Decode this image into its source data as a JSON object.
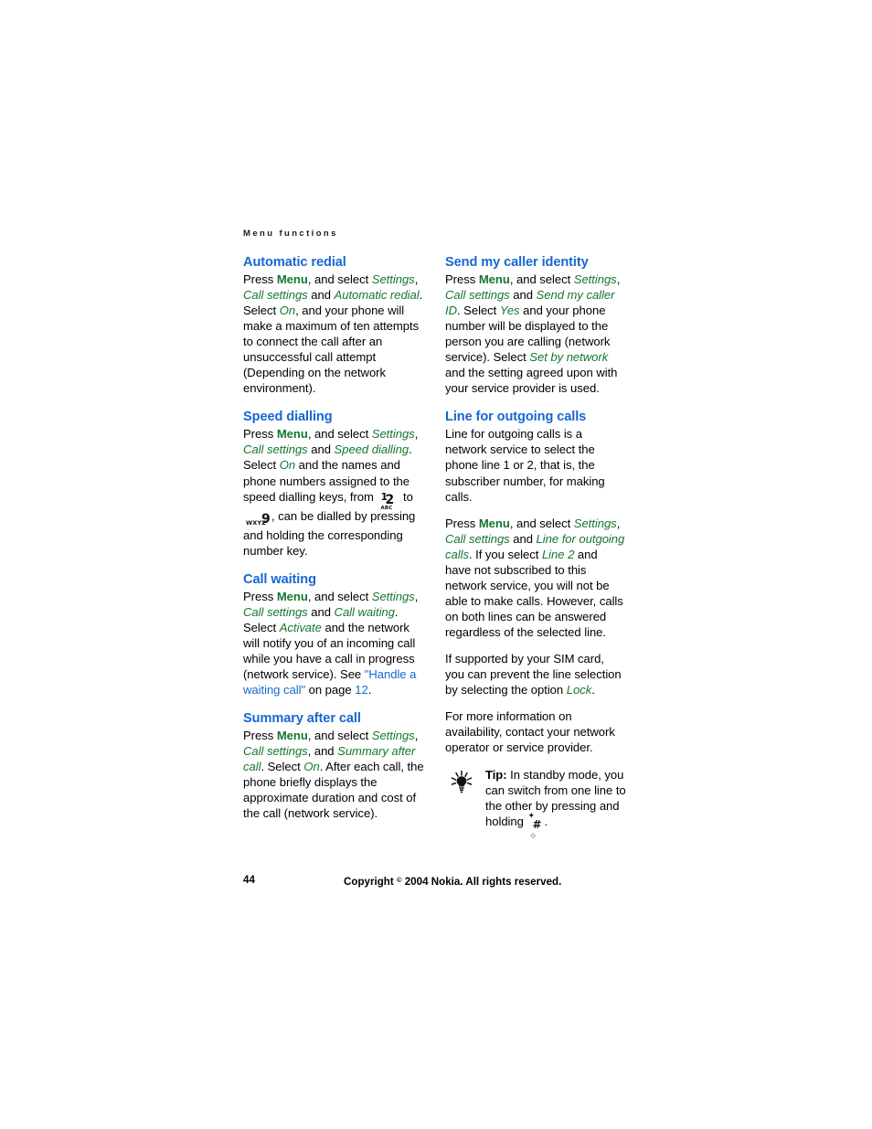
{
  "document": {
    "running_head": "Menu functions",
    "page_number": "44",
    "copyright_prefix": "Copyright ",
    "copyright_symbol": "©",
    "copyright_suffix": " 2004 Nokia. All rights reserved."
  },
  "colors": {
    "heading_blue": "#1767d2",
    "menu_green": "#14772f",
    "link_blue": "#1767d2",
    "body_black": "#000000",
    "page_background": "#ffffff"
  },
  "left_column": {
    "sections": [
      {
        "heading": "Automatic redial",
        "paragraphs": [
          {
            "runs": [
              {
                "t": "Press ",
                "s": "plain"
              },
              {
                "t": "Menu",
                "s": "bold-green"
              },
              {
                "t": ", and select ",
                "s": "plain"
              },
              {
                "t": "Settings",
                "s": "italic-green"
              },
              {
                "t": ", ",
                "s": "plain"
              },
              {
                "t": "Call settings",
                "s": "italic-green"
              },
              {
                "t": " and ",
                "s": "plain"
              },
              {
                "t": "Automatic redial",
                "s": "italic-green"
              },
              {
                "t": ". Select ",
                "s": "plain"
              },
              {
                "t": "On",
                "s": "italic-green"
              },
              {
                "t": ", and your phone will make a maximum of ten attempts to connect the call after an unsuccessful call attempt (Depending on the network environment).",
                "s": "plain"
              }
            ]
          }
        ]
      },
      {
        "heading": "Speed dialling",
        "paragraphs": [
          {
            "runs": [
              {
                "t": "Press ",
                "s": "plain"
              },
              {
                "t": "Menu",
                "s": "bold-green"
              },
              {
                "t": ", and select ",
                "s": "plain"
              },
              {
                "t": "Settings",
                "s": "italic-green"
              },
              {
                "t": ", ",
                "s": "plain"
              },
              {
                "t": "Call settings",
                "s": "italic-green"
              },
              {
                "t": " and ",
                "s": "plain"
              },
              {
                "t": "Speed dialling",
                "s": "italic-green"
              },
              {
                "t": ". Select ",
                "s": "plain"
              },
              {
                "t": "On",
                "s": "italic-green"
              },
              {
                "t": " and the names and phone numbers assigned to the speed dialling keys, from ",
                "s": "plain"
              },
              {
                "t": "key-2-abc",
                "s": "keycap-2"
              },
              {
                "t": " to ",
                "s": "plain"
              },
              {
                "t": "key-9-wxyz",
                "s": "keycap-9"
              },
              {
                "t": ", can be dialled by pressing and holding the corresponding number key.",
                "s": "plain"
              }
            ]
          }
        ]
      },
      {
        "heading": "Call waiting",
        "paragraphs": [
          {
            "runs": [
              {
                "t": "Press ",
                "s": "plain"
              },
              {
                "t": "Menu",
                "s": "bold-green"
              },
              {
                "t": ", and select ",
                "s": "plain"
              },
              {
                "t": "Settings",
                "s": "italic-green"
              },
              {
                "t": ", ",
                "s": "plain"
              },
              {
                "t": "Call settings",
                "s": "italic-green"
              },
              {
                "t": " and ",
                "s": "plain"
              },
              {
                "t": "Call waiting",
                "s": "italic-green"
              },
              {
                "t": ". Select ",
                "s": "plain"
              },
              {
                "t": "Activate",
                "s": "italic-green"
              },
              {
                "t": " and the network will notify you of an incoming call while you have a call in progress (network service). See ",
                "s": "plain"
              },
              {
                "t": "\"Handle a waiting call\"",
                "s": "link"
              },
              {
                "t": " on page ",
                "s": "plain"
              },
              {
                "t": "12",
                "s": "link"
              },
              {
                "t": ".",
                "s": "plain"
              }
            ]
          }
        ]
      },
      {
        "heading": "Summary after call",
        "paragraphs": [
          {
            "runs": [
              {
                "t": "Press ",
                "s": "plain"
              },
              {
                "t": "Menu",
                "s": "bold-green"
              },
              {
                "t": ", and select ",
                "s": "plain"
              },
              {
                "t": "Settings",
                "s": "italic-green"
              },
              {
                "t": ", ",
                "s": "plain"
              },
              {
                "t": "Call settings",
                "s": "italic-green"
              },
              {
                "t": ", and ",
                "s": "plain"
              },
              {
                "t": "Summary after call",
                "s": "italic-green"
              },
              {
                "t": ". Select ",
                "s": "plain"
              },
              {
                "t": "On",
                "s": "italic-green"
              },
              {
                "t": ". After each call, the phone briefly displays the approximate duration and cost of the call (network service).",
                "s": "plain"
              }
            ]
          }
        ]
      }
    ]
  },
  "right_column": {
    "sections": [
      {
        "heading": "Send my caller identity",
        "paragraphs": [
          {
            "runs": [
              {
                "t": "Press ",
                "s": "plain"
              },
              {
                "t": "Menu",
                "s": "bold-green"
              },
              {
                "t": ", and select ",
                "s": "plain"
              },
              {
                "t": "Settings",
                "s": "italic-green"
              },
              {
                "t": ", ",
                "s": "plain"
              },
              {
                "t": "Call settings",
                "s": "italic-green"
              },
              {
                "t": " and ",
                "s": "plain"
              },
              {
                "t": "Send my caller ID",
                "s": "italic-green"
              },
              {
                "t": ". Select ",
                "s": "plain"
              },
              {
                "t": "Yes",
                "s": "italic-green"
              },
              {
                "t": " and your phone number will be displayed to the person you are calling (network service). Select ",
                "s": "plain"
              },
              {
                "t": "Set by network",
                "s": "italic-green"
              },
              {
                "t": " and the setting agreed upon with your service provider is used.",
                "s": "plain"
              }
            ]
          }
        ]
      },
      {
        "heading": "Line for outgoing calls",
        "paragraphs": [
          {
            "runs": [
              {
                "t": "Line for outgoing calls is a network service to select the phone line 1 or 2, that is, the subscriber number, for making calls.",
                "s": "plain"
              }
            ]
          },
          {
            "runs": [
              {
                "t": "Press ",
                "s": "plain"
              },
              {
                "t": "Menu",
                "s": "bold-green"
              },
              {
                "t": ", and select ",
                "s": "plain"
              },
              {
                "t": "Settings",
                "s": "italic-green"
              },
              {
                "t": ", ",
                "s": "plain"
              },
              {
                "t": "Call settings",
                "s": "italic-green"
              },
              {
                "t": " and ",
                "s": "plain"
              },
              {
                "t": "Line for outgoing calls",
                "s": "italic-green"
              },
              {
                "t": ". If you select ",
                "s": "plain"
              },
              {
                "t": "Line 2",
                "s": "italic-green"
              },
              {
                "t": " and have not subscribed to this network service, you will not be able to make calls. However, calls on both lines can be answered regardless of the selected line.",
                "s": "plain"
              }
            ]
          },
          {
            "runs": [
              {
                "t": "If supported by your SIM card, you can prevent the line selection by selecting the option ",
                "s": "plain"
              },
              {
                "t": "Lock",
                "s": "italic-green"
              },
              {
                "t": ".",
                "s": "plain"
              }
            ]
          },
          {
            "runs": [
              {
                "t": "For more information on availability, contact your network operator or service provider.",
                "s": "plain"
              }
            ]
          }
        ],
        "tip": {
          "icon": "lightbulb-tip-icon",
          "label": "Tip:",
          "runs": [
            {
              "t": " In standby mode, you can switch from one line to the other by pressing and holding ",
              "s": "plain"
            },
            {
              "t": "key-hash",
              "s": "keycap-hash"
            },
            {
              "t": ".",
              "s": "plain"
            }
          ]
        }
      }
    ]
  },
  "keycaps": {
    "key2": {
      "number": "2",
      "alpha": "ABC"
    },
    "key9": {
      "number": "9",
      "alpha": "WXYZ"
    },
    "keyhash": {
      "number": "#"
    }
  }
}
